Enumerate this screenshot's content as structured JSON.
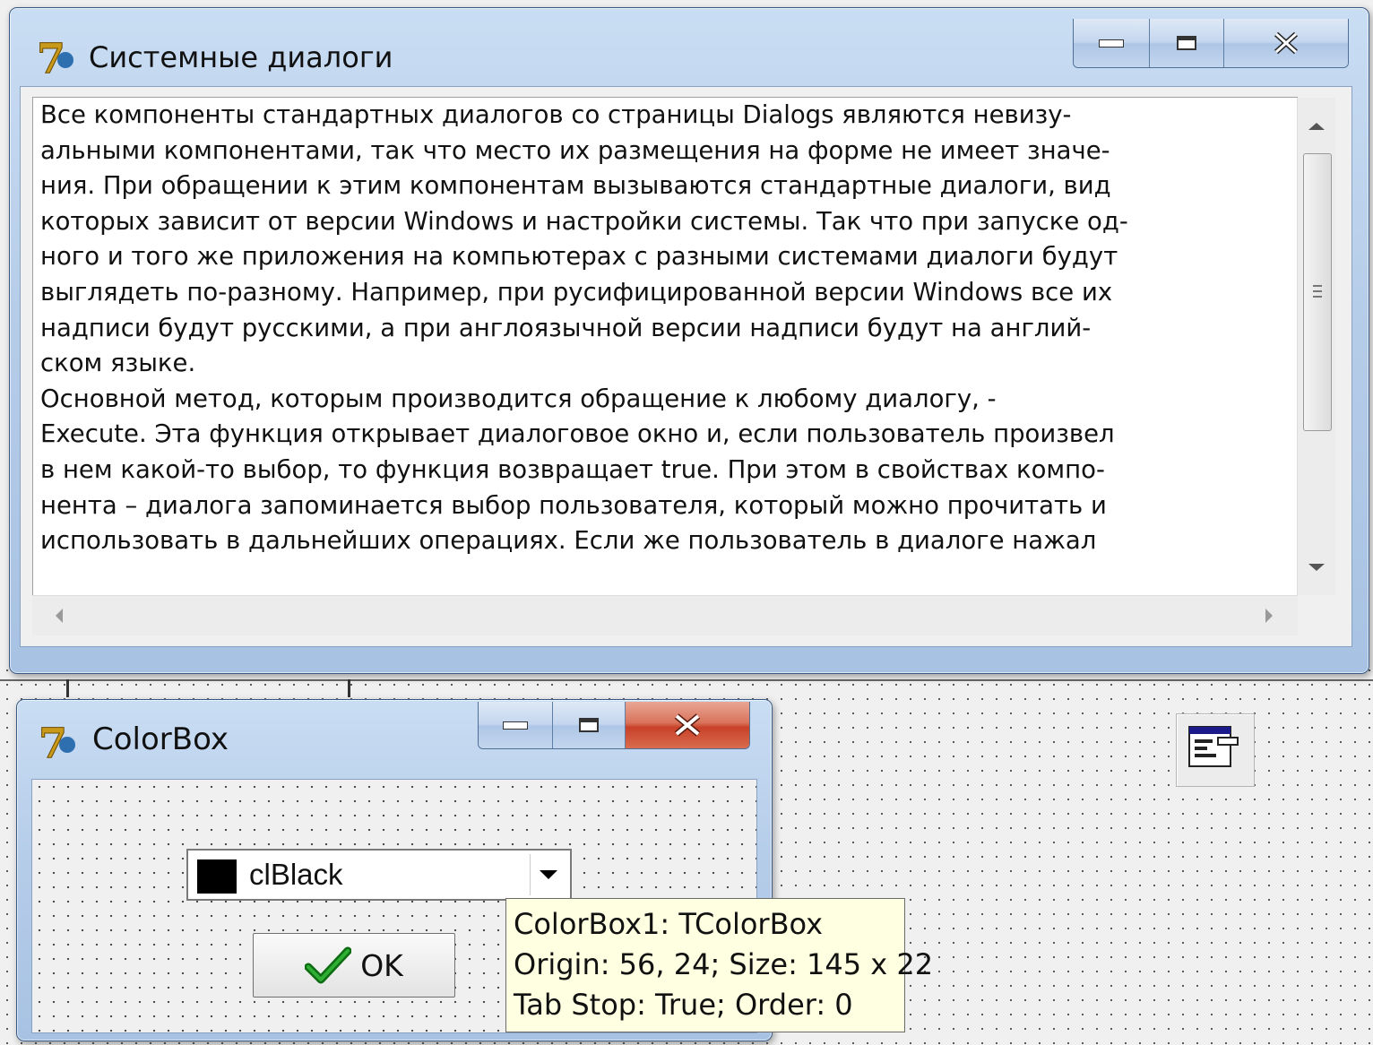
{
  "memo_window": {
    "title": "Системные диалоги",
    "lines": [
      "Все компоненты стандартных диалогов со страницы Dialogs являются невизу-",
      "альными компонентами, так что место их размещения на форме не имеет значе-",
      "ния. При обращении к этим компонентам вызываются стандартные диалоги, вид",
      "которых зависит от версии Windows и настройки системы. Так что при запуске од-",
      "ного и того же приложения на компьютерах с разными системами диалоги будут",
      "выглядеть по-разному. Например, при русифицированной версии Windows все их",
      "надписи будут русскими, а при англоязычной версии надписи будут на англий-",
      "ском языке.",
      "Основной метод, которым производится обращение к любому диалогу, -",
      "Execute. Эта функция открывает диалоговое окно и, если пользователь произвел",
      "в нем какой-то выбор, то функция возвращает true. При этом в свойствах компо-",
      "нента – диалога запоминается выбор пользователя, который можно прочитать и",
      "использовать в дальнейших операциях. Если же пользователь в диалоге нажал"
    ]
  },
  "colorbox_window": {
    "title": "ColorBox",
    "combo": {
      "value": "clBlack",
      "swatch_color": "#000000"
    },
    "ok_button": {
      "label": "OK"
    }
  },
  "tooltip": {
    "line1": "ColorBox1: TColorBox",
    "line2": "Origin: 56, 24; Size: 145 x 22",
    "line3": "Tab Stop: True; Order: 0"
  },
  "icons": {
    "app": "delphi-7-icon",
    "minimize": "minimize-icon",
    "maximize": "maximize-icon",
    "close": "close-icon",
    "checkmark": "check-icon",
    "component": "dialog-component-icon"
  },
  "colors": {
    "tooltip_bg": "#ffffe1",
    "close_button_active": "#c84128"
  }
}
